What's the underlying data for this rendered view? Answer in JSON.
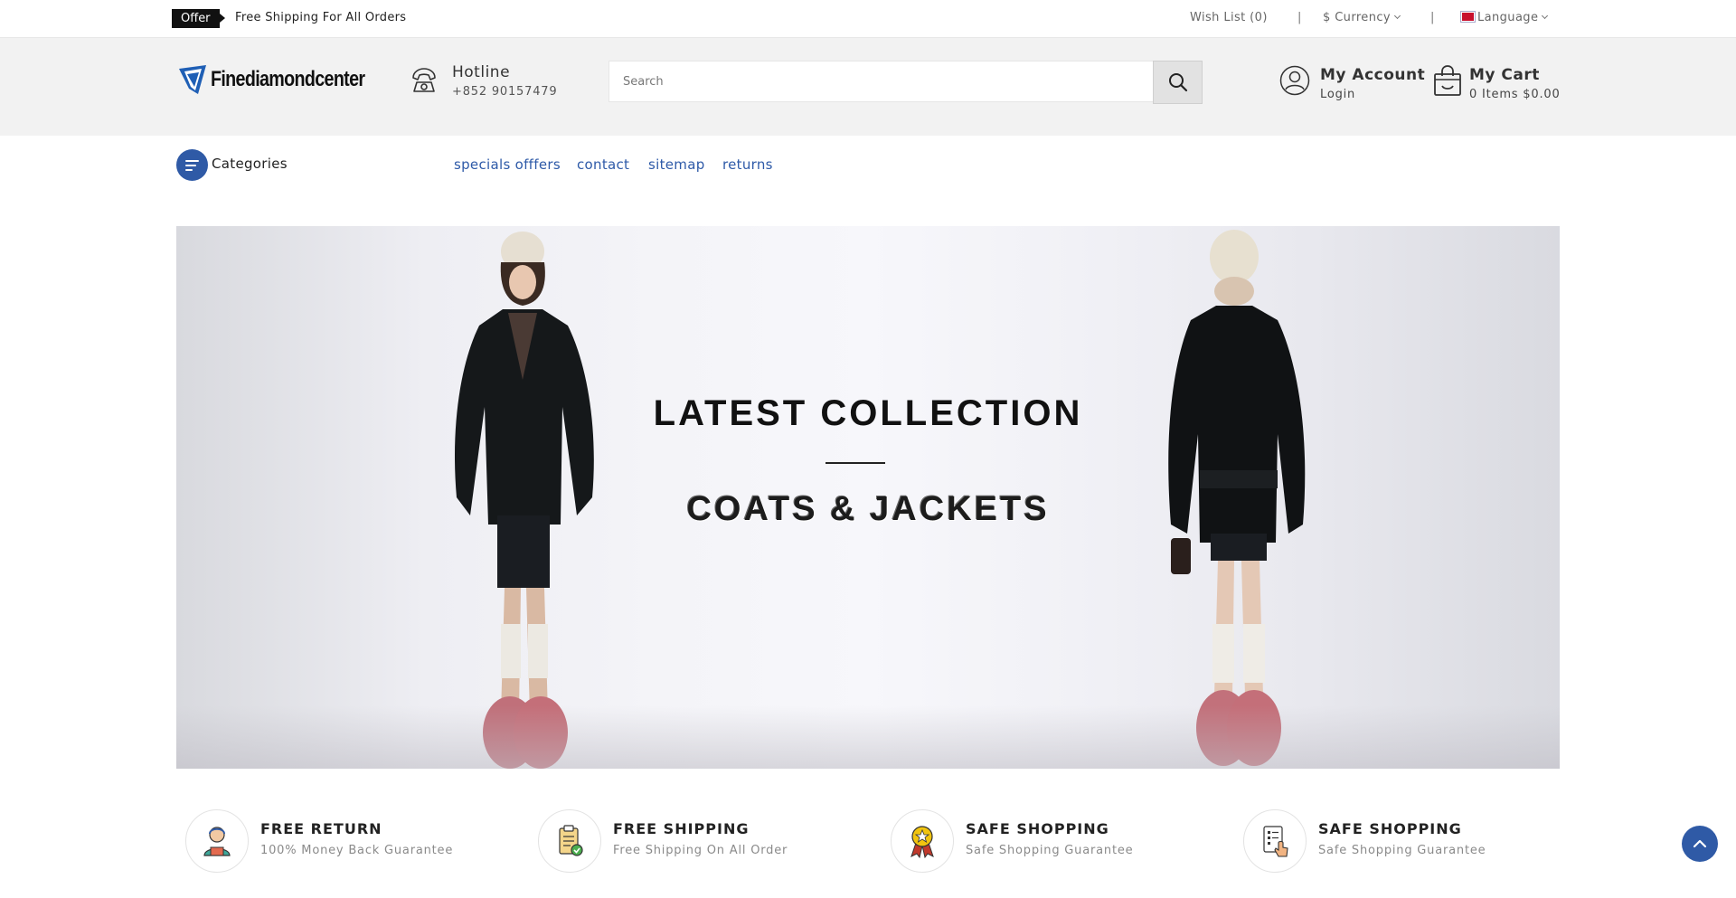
{
  "topbar": {
    "offer_badge": "Offer",
    "offer_text": "Free Shipping For All Orders",
    "wishlist": "Wish List (0)",
    "separator": "|",
    "currency": "$ Currency",
    "language": "Language"
  },
  "header": {
    "logo_text": "Finediamondcenter",
    "hotline_title": "Hotline",
    "hotline_number": "+852 90157479",
    "search_placeholder": "Search",
    "account_title": "My Account",
    "account_sub": "Login",
    "cart_title": "My Cart",
    "cart_sub": "0 Items $0.00"
  },
  "nav": {
    "categories_label": "Categories",
    "links": [
      "specials offfers",
      "contact",
      "sitemap",
      "returns"
    ]
  },
  "banner": {
    "title": "LATEST COLLECTION",
    "subtitle": "COATS & JACKETS"
  },
  "features": [
    {
      "title": "FREE RETURN",
      "sub": "100% Money Back Guarantee",
      "icon": "support-agent-icon"
    },
    {
      "title": "FREE SHIPPING",
      "sub": "Free Shipping On All Order",
      "icon": "checklist-icon"
    },
    {
      "title": "SAFE SHOPPING",
      "sub": "Safe Shopping Guarantee",
      "icon": "medal-icon"
    },
    {
      "title": "SAFE SHOPPING",
      "sub": "Safe Shopping Guarantee",
      "icon": "touch-list-icon"
    }
  ],
  "colors": {
    "accent": "#2f5aa6",
    "link": "#2e5aa8",
    "header_bg": "#f2f2f2"
  }
}
